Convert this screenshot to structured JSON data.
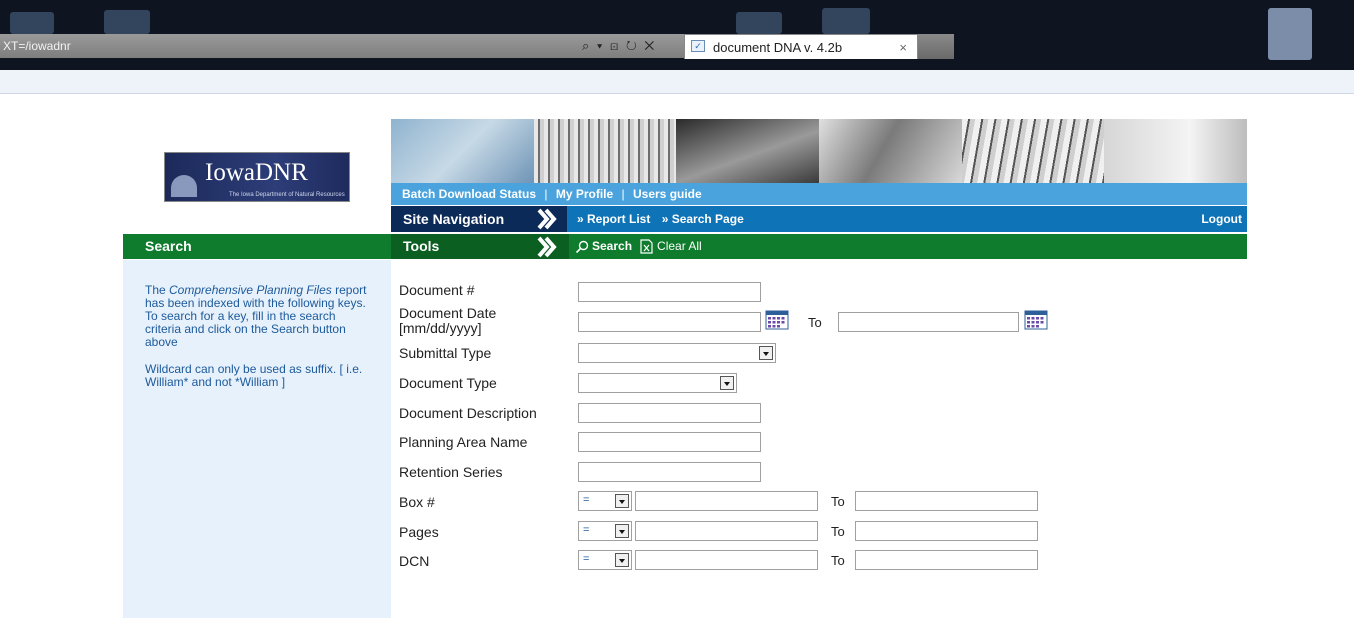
{
  "browser": {
    "address_text": "XT=/iowadnr",
    "address_buttons": "⌕ ▾ ⊡ ↻ ✕",
    "tab_title": "document DNA v. 4.2b",
    "tab_close": "×"
  },
  "logo": {
    "name": "IowaDNR",
    "subtitle": "The Iowa Department of Natural Resources"
  },
  "linkbar": {
    "batch": "Batch Download Status",
    "sep": "|",
    "profile": "My Profile",
    "guide": "Users guide"
  },
  "navigation": {
    "label": "Site Navigation",
    "report_list": "» Report List",
    "search_page": "» Search Page",
    "logout": "Logout"
  },
  "search_header": "Search",
  "tools": {
    "label": "Tools",
    "search": "Search",
    "clear_all": "Clear All"
  },
  "sidebar": {
    "intro_pre": "The ",
    "intro_em": "Comprehensive Planning Files",
    "intro_post": " report has been indexed with the following keys. To search for a key, fill in the search criteria and click on the Search button above",
    "wildcard": "Wildcard can only be used as suffix. [ i.e. William* and not *William ]"
  },
  "form": {
    "document_no": "Document #",
    "document_date_line1": "Document Date",
    "document_date_line2": "[mm/dd/yyyy]",
    "to": "To",
    "submittal_type": "Submittal Type",
    "document_type": "Document Type",
    "document_description": "Document Description",
    "planning_area_name": "Planning Area Name",
    "retention_series": "Retention Series",
    "box_no": "Box #",
    "pages": "Pages",
    "dcn": "DCN",
    "operator": "="
  },
  "colors": {
    "nav_blue": "#0f73b7",
    "link_blue": "#4aa3dc",
    "tools_green": "#0e7c2c",
    "sidebar_bg": "#e6f1fb"
  }
}
